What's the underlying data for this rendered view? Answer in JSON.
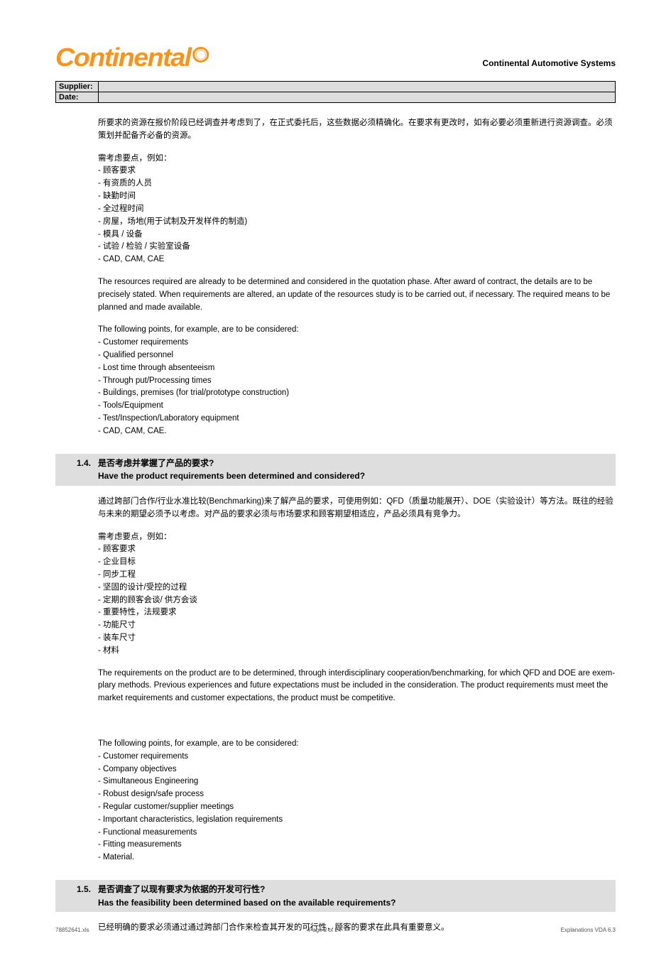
{
  "header": {
    "logo_text": "Continental",
    "brand": "Continental Automotive Systems"
  },
  "meta": {
    "supplier_label": "Supplier:",
    "supplier_value": "",
    "date_label": "Date:",
    "date_value": ""
  },
  "body": {
    "p1": "所要求的资源在报价阶段已经调查并考虑到了，在正式委托后，这些数据必须精确化。在要求有更改时，如有必要必须重新进行资源调查。必须策划并配备齐必备的资源。",
    "p2h": "需考虑要点，例如：",
    "p2a": "- 顾客要求",
    "p2b": "- 有资质的人员",
    "p2c": "- 缺勤时间",
    "p2d": "- 全过程时间",
    "p2e": "- 房屋，场地(用于试制及开发样件的制造)",
    "p2f": "- 模具 / 设备",
    "p2g": "- 试验 / 检验 / 实验室设备",
    "p2i": "- CAD, CAM, CAE",
    "p3": "The resources required are already to be determined and considered in the quotation phase. After award of contract, the details are to be precisely stated. When requirements are altered, an update of the resources study is to be carried out, if necessary. The required means to be planned and made available.",
    "p4h": "The following points, for example, are to be considered:",
    "p4a": "- Customer requirements",
    "p4b": "- Qualified personnel",
    "p4c": "- Lost time through absenteeism",
    "p4d": "- Through put/Processing times",
    "p4e": "- Buildings, premises (for trial/prototype construction)",
    "p4f": "- Tools/Equipment",
    "p4g": "- Test/Inspection/Laboratory equipment",
    "p4i": "- CAD, CAM, CAE."
  },
  "s14": {
    "num": "1.4.",
    "t_cn": "是否考虑并掌握了产品的要求?",
    "t_en": "Have the product requirements been determined and considered?",
    "p1": "通过跨部门合作/行业水准比较(Benchmarking)来了解产品的要求，可使用例如：QFD（质量功能展开）、DOE（实验设计）等方法。既往的经验与未来的期望必须予以考虑。对产品的要求必须与市场要求和顾客期望相适应，产品必须具有竞争力。",
    "p2h": "需考虑要点，例如：",
    "p2a": "- 顾客要求",
    "p2b": "- 企业目标",
    "p2c": "- 同步工程",
    "p2d": "- 坚固的设计/受控的过程",
    "p2e": "- 定期的顾客会谈/ 供方会谈",
    "p2f": "- 重要特性，法规要求",
    "p2g": "- 功能尺寸",
    "p2i": "- 装车尺寸",
    "p2j": "- 材料",
    "p3": "The requirements on the product are to be determined, through interdisciplinary cooperation/benchmarking, for which QFD and DOE are exem-plary methods. Previous experiences and future expectations must be included in the consideration. The product requirements must meet the market requirements and customer expectations, the product must be competitive.",
    "p4h": "The following points, for example, are to be considered:",
    "p4a": "- Customer requirements",
    "p4b": "- Company objectives",
    "p4c": "- Simultaneous Engineering",
    "p4d": "- Robust design/safe process",
    "p4e": "- Regular customer/supplier meetings",
    "p4f": "- Important characteristics, legislation requirements",
    "p4g": "- Functional measurements",
    "p4i": "- Fitting measurements",
    "p4j": "- Material."
  },
  "s15": {
    "num": "1.5.",
    "t_cn": "是否调查了以现有要求为依据的开发可行性?",
    "t_en": "Has the feasibility been determined based on the available requirements?",
    "p1": "已经明确的要求必须通过通过跨部门合作来检查其开发的可行性，顾客的要求在此具有重要意义。"
  },
  "footer": {
    "left": "78852641.xls",
    "center": "Page 2 of 24",
    "right": "Explanations VDA 6.3"
  }
}
